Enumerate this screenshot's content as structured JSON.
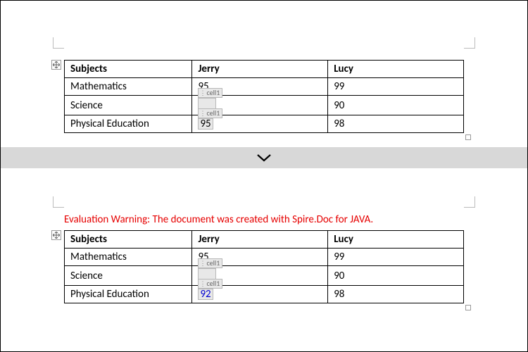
{
  "warning_text": "Evaluation Warning: The document was created with Spire.Doc for JAVA.",
  "content_control_label": "cell1",
  "table1": {
    "headers": [
      "Subjects",
      "Jerry",
      "Lucy"
    ],
    "rows": [
      {
        "subject": "Mathematics",
        "jerry": "95",
        "lucy": "99"
      },
      {
        "subject": "Science",
        "jerry_cc": "",
        "lucy": "90"
      },
      {
        "subject": "Physical Education",
        "jerry_cc": "95",
        "lucy": "98"
      }
    ]
  },
  "table2": {
    "headers": [
      "Subjects",
      "Jerry",
      "Lucy"
    ],
    "rows": [
      {
        "subject": "Mathematics",
        "jerry": "95",
        "lucy": "99"
      },
      {
        "subject": "Science",
        "jerry_cc": "",
        "lucy": "90"
      },
      {
        "subject": "Physical Education",
        "jerry_cc": "92",
        "lucy": "98"
      }
    ]
  }
}
